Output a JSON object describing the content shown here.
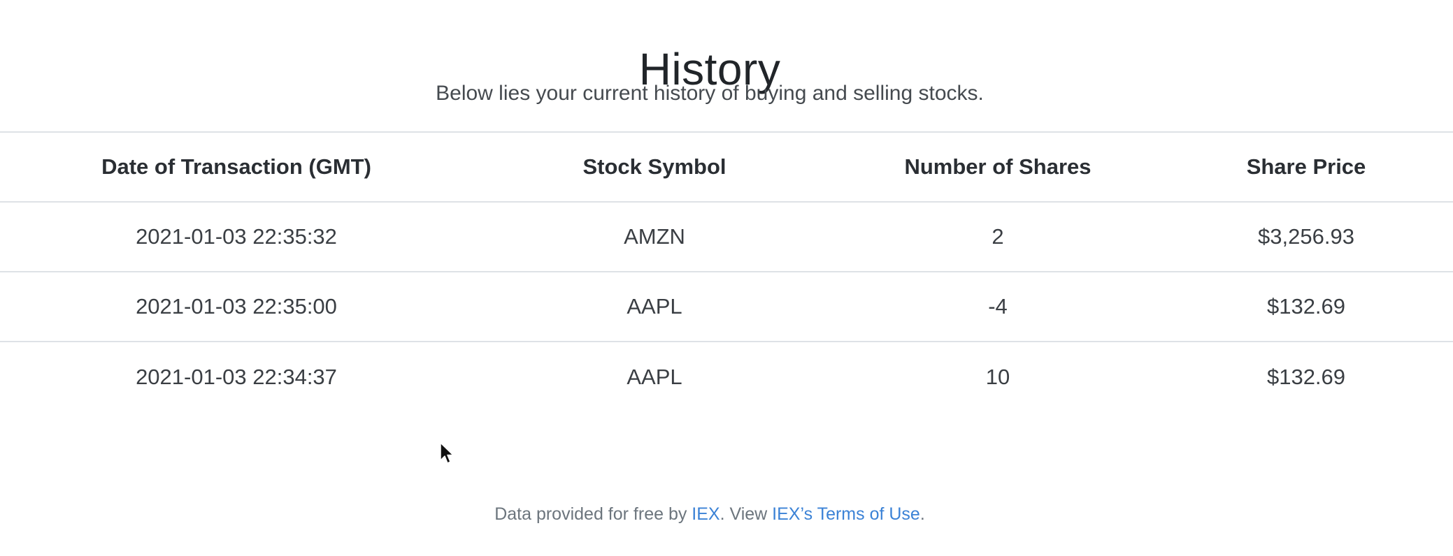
{
  "page": {
    "title": "History",
    "subtitle": "Below lies your current history of buying and selling stocks."
  },
  "table": {
    "headers": {
      "date": "Date of Transaction (GMT)",
      "symbol": "Stock Symbol",
      "shares": "Number of Shares",
      "price": "Share Price"
    },
    "rows": [
      {
        "date": "2021-01-03 22:35:32",
        "symbol": "AMZN",
        "shares": "2",
        "price": "$3,256.93"
      },
      {
        "date": "2021-01-03 22:35:00",
        "symbol": "AAPL",
        "shares": "-4",
        "price": "$132.69"
      },
      {
        "date": "2021-01-03 22:34:37",
        "symbol": "AAPL",
        "shares": "10",
        "price": "$132.69"
      }
    ]
  },
  "footer": {
    "prefix": "Data provided for free by ",
    "iex_link": "IEX",
    "middle": ". View ",
    "terms_link": "IEX’s Terms of Use",
    "suffix": "."
  },
  "colors": {
    "link": "#3b82d6",
    "text": "#212529",
    "muted": "#6c757d",
    "border": "#dee2e6"
  },
  "icons": {
    "cursor": "mouse-pointer-icon"
  }
}
